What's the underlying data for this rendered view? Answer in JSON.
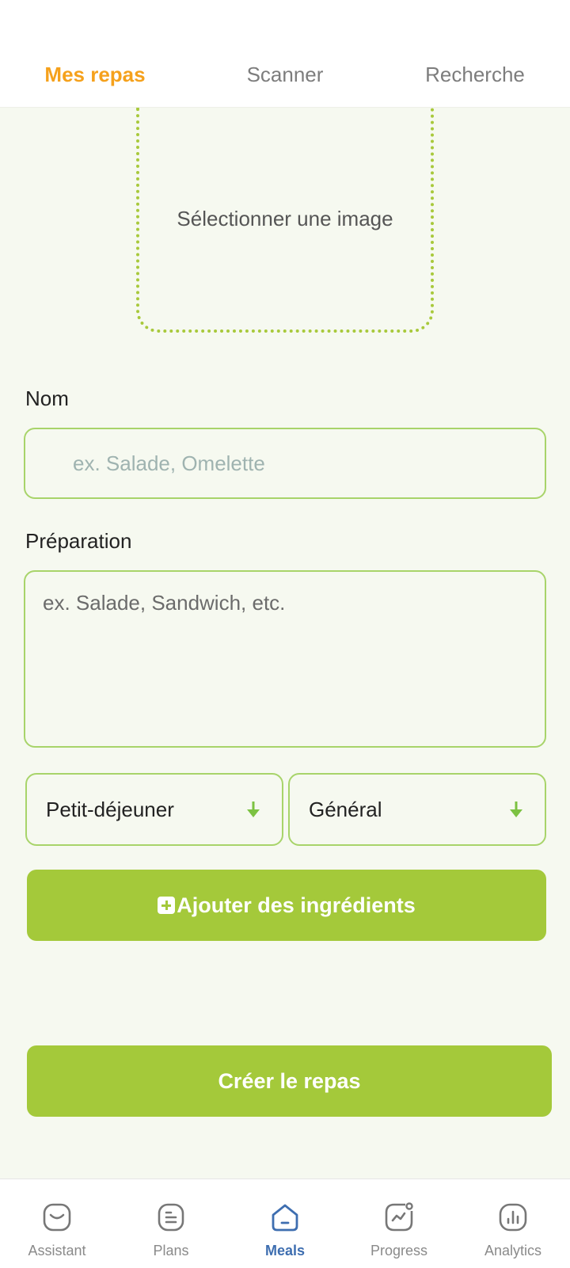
{
  "top_tabs": [
    {
      "label": "Mes repas",
      "active": true
    },
    {
      "label": "Scanner",
      "active": false
    },
    {
      "label": "Recherche",
      "active": false
    }
  ],
  "image_picker": {
    "label": "Sélectionner une image"
  },
  "form": {
    "name_label": "Nom",
    "name_placeholder": "ex. Salade, Omelette",
    "name_value": "",
    "prep_label": "Préparation",
    "prep_placeholder": "ex. Salade, Sandwich, etc.",
    "prep_value": "",
    "meal_type_value": "Petit-déjeuner",
    "category_value": "Général",
    "add_ingredients_label": "Ajouter des ingrédients",
    "create_label": "Créer le repas"
  },
  "bottom_nav": [
    {
      "label": "Assistant",
      "icon": "assistant-icon",
      "active": false
    },
    {
      "label": "Plans",
      "icon": "plans-icon",
      "active": false
    },
    {
      "label": "Meals",
      "icon": "meals-home-icon",
      "active": true
    },
    {
      "label": "Progress",
      "icon": "progress-icon",
      "active": false
    },
    {
      "label": "Analytics",
      "icon": "analytics-icon",
      "active": false
    }
  ],
  "colors": {
    "accent_orange": "#f5a11c",
    "accent_green": "#a4c93a",
    "border_green": "#a8d46a",
    "background": "#f6f9f0",
    "nav_active": "#3e6eb0"
  }
}
